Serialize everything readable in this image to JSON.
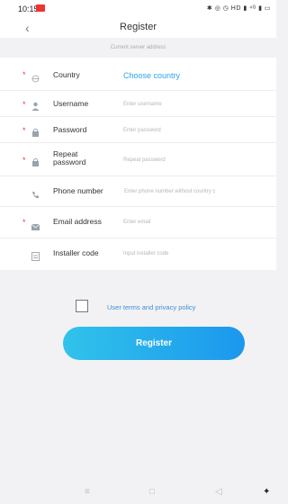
{
  "status": {
    "time": "10:15",
    "icons": "✱ ◎ ◷ HD ▮ ⁴ᴳ ▮ ▭"
  },
  "header": {
    "title": "Register",
    "back_icon": "chevron-left"
  },
  "server": "Current server address",
  "fields": [
    {
      "key": "country",
      "label": "Country",
      "value": "Choose country",
      "required": true,
      "icon": "globe"
    },
    {
      "key": "username",
      "label": "Username",
      "placeholder": "Enter username",
      "required": true,
      "icon": "user"
    },
    {
      "key": "password",
      "label": "Password",
      "placeholder": "Enter password",
      "required": true,
      "icon": "lock"
    },
    {
      "key": "repeat",
      "label": "Repeat password",
      "placeholder": "Repeat password",
      "required": true,
      "icon": "lock"
    },
    {
      "key": "phone",
      "label": "Phone number",
      "placeholder": "Enter phone number without country c",
      "required": false,
      "icon": "phone"
    },
    {
      "key": "email",
      "label": "Email address",
      "placeholder": "Enter email",
      "required": true,
      "icon": "mail"
    },
    {
      "key": "installer",
      "label": "Installer code",
      "placeholder": "Input installer code",
      "required": false,
      "icon": "id-card"
    }
  ],
  "required_mark": "*",
  "terms": "User terms and privacy policy",
  "register_button": "Register",
  "nav": {
    "menu": "≡",
    "home": "□",
    "back": "◁",
    "accessibility": "✦"
  }
}
